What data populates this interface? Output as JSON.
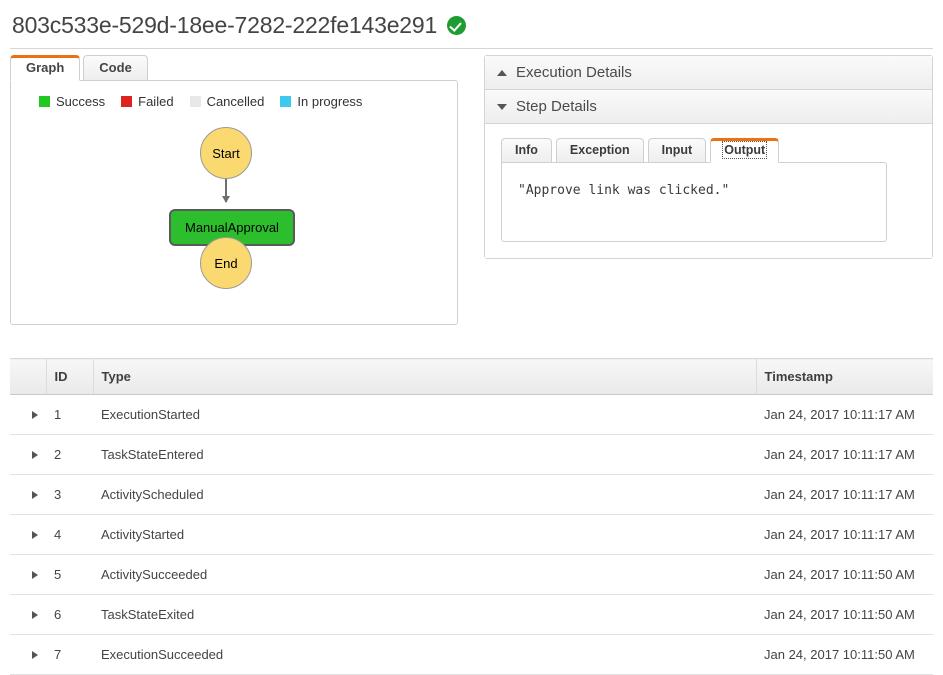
{
  "header": {
    "execution_id": "803c533e-529d-18ee-7282-222fe143e291",
    "status_icon": "success-check-icon"
  },
  "left_panel": {
    "tabs": [
      {
        "label": "Graph",
        "active": true
      },
      {
        "label": "Code",
        "active": false
      }
    ],
    "legend": [
      {
        "label": "Success",
        "color": "#22c722"
      },
      {
        "label": "Failed",
        "color": "#dd2222"
      },
      {
        "label": "Cancelled",
        "color": "#e8e8e8"
      },
      {
        "label": "In progress",
        "color": "#3fc8ed"
      }
    ],
    "graph": {
      "nodes": [
        {
          "id": "start",
          "label": "Start",
          "shape": "circle",
          "color": "#fbd971"
        },
        {
          "id": "manual-approval",
          "label": "ManualApproval",
          "shape": "rect",
          "color": "#2dbe2d"
        },
        {
          "id": "end",
          "label": "End",
          "shape": "circle",
          "color": "#fbd971"
        }
      ],
      "edges": [
        {
          "from": "start",
          "to": "manual-approval"
        },
        {
          "from": "manual-approval",
          "to": "end"
        }
      ]
    }
  },
  "right_panel": {
    "execution_details": {
      "title": "Execution Details",
      "expanded": false,
      "toggle_icon": "triangle-up-icon"
    },
    "step_details": {
      "title": "Step Details",
      "expanded": true,
      "toggle_icon": "triangle-down-icon"
    },
    "step_tabs": [
      {
        "label": "Info",
        "active": false
      },
      {
        "label": "Exception",
        "active": false
      },
      {
        "label": "Input",
        "active": false
      },
      {
        "label": "Output",
        "active": true
      }
    ],
    "output_content": "\"Approve link was clicked.\""
  },
  "events_table": {
    "columns": [
      "",
      "ID",
      "Type",
      "Timestamp"
    ],
    "rows": [
      {
        "id": "1",
        "type": "ExecutionStarted",
        "timestamp": "Jan 24, 2017 10:11:17 AM"
      },
      {
        "id": "2",
        "type": "TaskStateEntered",
        "timestamp": "Jan 24, 2017 10:11:17 AM"
      },
      {
        "id": "3",
        "type": "ActivityScheduled",
        "timestamp": "Jan 24, 2017 10:11:17 AM"
      },
      {
        "id": "4",
        "type": "ActivityStarted",
        "timestamp": "Jan 24, 2017 10:11:17 AM"
      },
      {
        "id": "5",
        "type": "ActivitySucceeded",
        "timestamp": "Jan 24, 2017 10:11:50 AM"
      },
      {
        "id": "6",
        "type": "TaskStateExited",
        "timestamp": "Jan 24, 2017 10:11:50 AM"
      },
      {
        "id": "7",
        "type": "ExecutionSucceeded",
        "timestamp": "Jan 24, 2017 10:11:50 AM"
      }
    ]
  }
}
